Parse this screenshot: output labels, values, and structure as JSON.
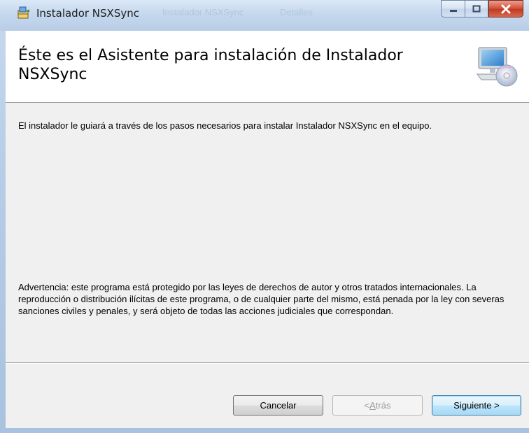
{
  "window": {
    "title": "Instalador NSXSync",
    "background_hints": [
      "Instalador NSXSync",
      "Detalles"
    ],
    "caption_buttons": [
      "minimize",
      "maximize",
      "close"
    ]
  },
  "banner": {
    "title": "Éste es el Asistente para instalación de Instalador NSXSync",
    "icon": "computer-cd-icon"
  },
  "body": {
    "intro": "El instalador le guiará a través de los pasos necesarios para instalar Instalador NSXSync en el equipo.",
    "warning": "Advertencia: este programa está protegido por las leyes de derechos de autor y otros tratados internacionales. La reproducción o distribución ilícitas de este programa, o de cualquier parte del mismo, está penada por la ley con severas sanciones civiles y penales, y será objeto de todas las acciones judiciales que correspondan."
  },
  "buttons": {
    "cancel": "Cancelar",
    "back_prefix": "< ",
    "back_access": "A",
    "back_rest": "trás",
    "next": "Siguiente >"
  },
  "colors": {
    "accent": "#3c7fb1",
    "close": "#c03a22"
  }
}
